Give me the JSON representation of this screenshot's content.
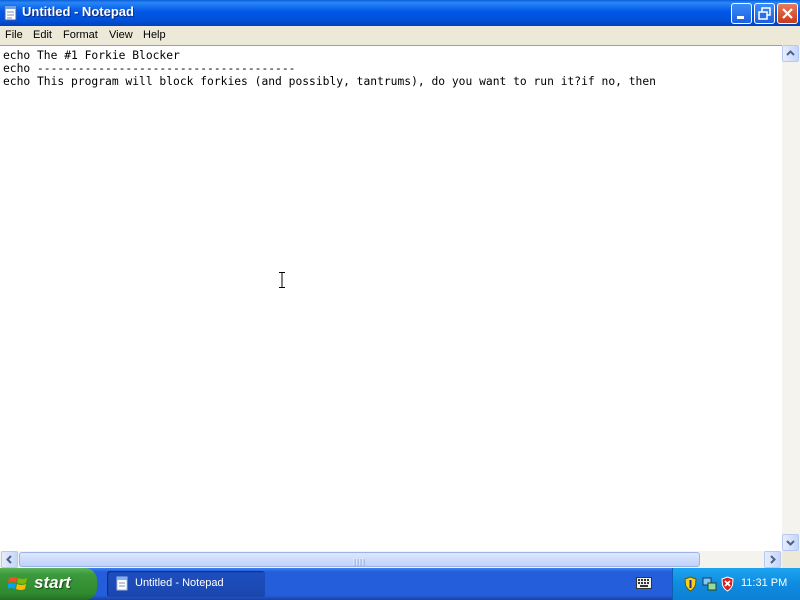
{
  "window": {
    "title": "Untitled - Notepad"
  },
  "menu": {
    "items": [
      "File",
      "Edit",
      "Format",
      "View",
      "Help"
    ]
  },
  "document": {
    "lines": [
      "echo The #1 Forkie Blocker",
      "echo --------------------------------------",
      "echo This program will block forkies (and possibly, tantrums), do you want to run it?if no, then"
    ]
  },
  "taskbar": {
    "start_label": "start",
    "task_label": "Untitled - Notepad",
    "clock": "11:31 PM"
  },
  "icons": {
    "app": "notepad-icon",
    "minimize": "minimize-icon",
    "maximize": "restore-icon",
    "close": "close-icon",
    "start": "windows-logo-icon",
    "keyboard": "keyboard-icon",
    "tray": [
      "security-shield-icon",
      "network-icon",
      "security-alert-icon"
    ]
  },
  "colors": {
    "titlebar": "#0058e6",
    "taskbar": "#245edb",
    "start_button": "#3b9a3b",
    "tray": "#0f8ce0",
    "menubar": "#ece9d8"
  }
}
